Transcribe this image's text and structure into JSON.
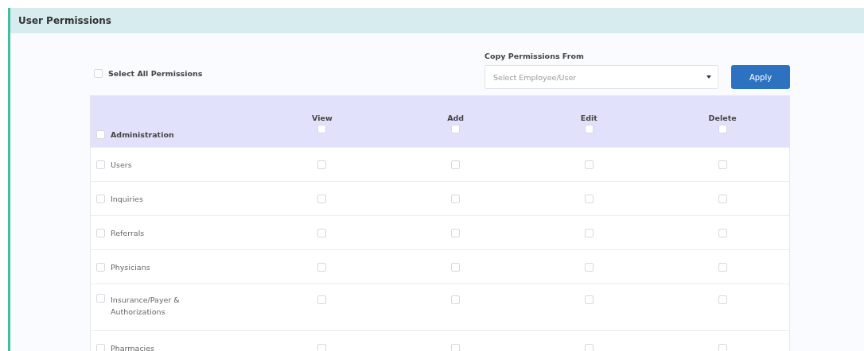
{
  "panel": {
    "title": "User Permissions"
  },
  "select_all": {
    "label": "Select All Permissions",
    "checked": false
  },
  "copy_from": {
    "label": "Copy Permissions From",
    "placeholder": "Select Employee/User",
    "button": "Apply"
  },
  "table": {
    "group": {
      "label": "Administration",
      "checked": false
    },
    "columns": [
      {
        "label": "View",
        "checked": false
      },
      {
        "label": "Add",
        "checked": false
      },
      {
        "label": "Edit",
        "checked": false
      },
      {
        "label": "Delete",
        "checked": false
      }
    ],
    "rows": [
      {
        "label": "Users",
        "checked": false,
        "perms": [
          false,
          false,
          false,
          false
        ]
      },
      {
        "label": "Inquiries",
        "checked": false,
        "perms": [
          false,
          false,
          false,
          false
        ]
      },
      {
        "label": "Referrals",
        "checked": false,
        "perms": [
          false,
          false,
          false,
          false
        ]
      },
      {
        "label": "Physicians",
        "checked": false,
        "perms": [
          false,
          false,
          false,
          false
        ]
      },
      {
        "label": "Insurance/Payer & Authorizations",
        "checked": false,
        "perms": [
          false,
          false,
          false,
          false
        ]
      },
      {
        "label": "Pharmacies",
        "checked": false,
        "perms": [
          false,
          false,
          false,
          false
        ]
      }
    ]
  }
}
